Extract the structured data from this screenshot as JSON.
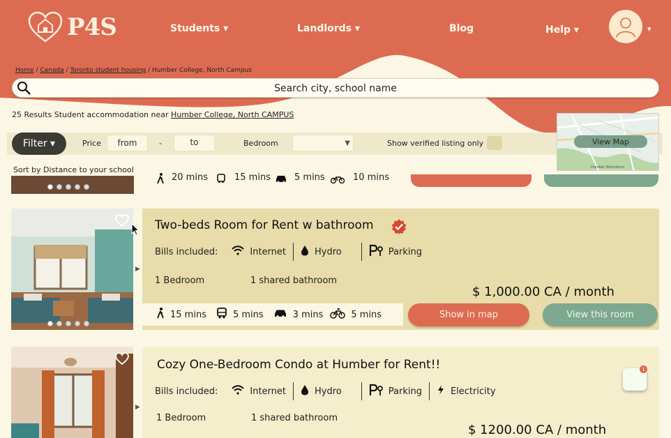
{
  "brand": {
    "logo_text": "P4S"
  },
  "nav": {
    "students": "Students ▾",
    "landlords": "Landlords ▾",
    "blog": "Blog",
    "help": "Help ▾",
    "avatar_caret": "▾"
  },
  "breadcrumb": {
    "home": "Home",
    "sep1": " / ",
    "canada": "Canada",
    "sep2": " / ",
    "city": "Toronto student housing",
    "sep3": " / ",
    "current": "Humber College, North Campus"
  },
  "search": {
    "placeholder": "Search city, school name"
  },
  "results": {
    "prefix": "25 Results Student accommodation near ",
    "link": "Humber College, North CAMPUS"
  },
  "filters": {
    "filter_label": "Filter ▾",
    "price_label": "Price",
    "from": "from",
    "dash": "-",
    "to": "to",
    "bedroom_label": "Bedroom",
    "bedroom_caret": "▼",
    "verified_label": "Show verified listing only",
    "sort_label": "Sort by",
    "sort_value": "Distance to your school"
  },
  "map": {
    "view_label": "View Map",
    "caption": "Humber Arboretum"
  },
  "prev_card": {
    "walk": "20 mins",
    "bus": "15 mins",
    "car": "5 mins",
    "bike": "10 mins"
  },
  "listings": [
    {
      "title": "Two-beds Room for Rent w bathroom",
      "verified": true,
      "bills_label": "Bills included:",
      "bills": [
        "Internet",
        "Hydro",
        "Parking"
      ],
      "bedrooms": "1 Bedroom",
      "bathroom": "1 shared bathroom",
      "price": "$ 1,000.00 CA / month",
      "walk": "15 mins",
      "bus": "5 mins",
      "car": "3 mins",
      "bike": "5 mins",
      "show_map": "Show in map",
      "view_room": "View this room"
    },
    {
      "title": "Cozy One-Bedroom Condo at Humber for Rent!!",
      "bills_label": "Bills included:",
      "bills": [
        "Internet",
        "Hydro",
        "Parking",
        "Electricity"
      ],
      "bedrooms": "1 Bedroom",
      "bathroom": "1 shared bathroom",
      "price": "$ 1200.00 CA / month"
    }
  ],
  "notification": {
    "count": "1"
  },
  "colors": {
    "primary": "#dd6b52",
    "green": "#7da88f",
    "cream": "#fbf7e4",
    "card": "#e7dcaa"
  }
}
